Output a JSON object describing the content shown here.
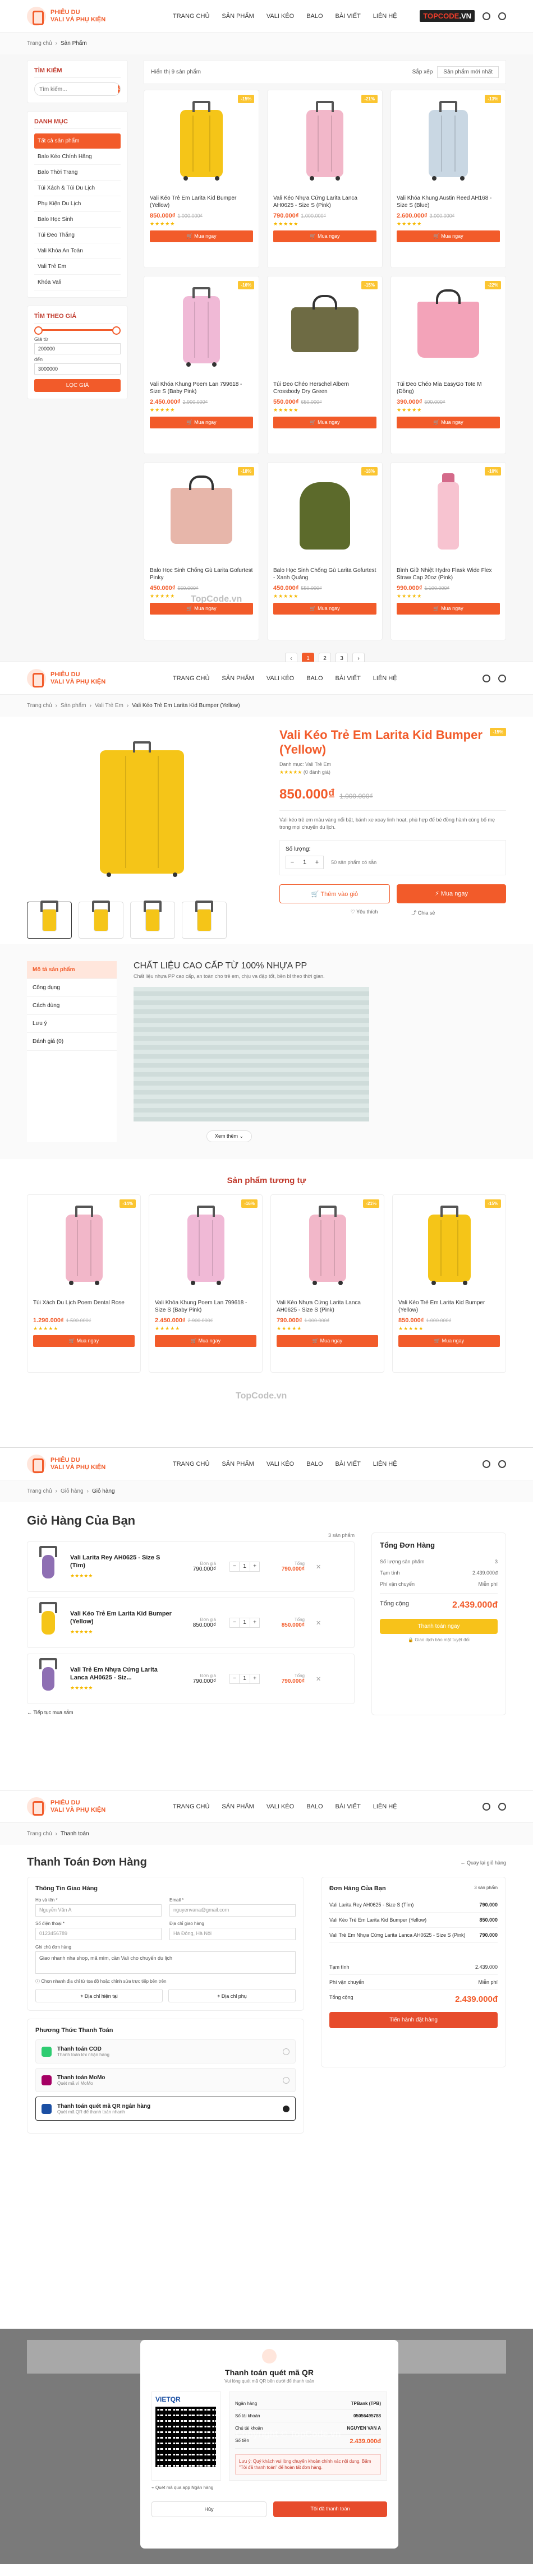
{
  "brand": {
    "line1": "PHIÊU DU",
    "line2": "VALI VÀ PHỤ KIỆN",
    "accent": "#f25b2a"
  },
  "nav": [
    "TRANG CHỦ",
    "SẢN PHẨM",
    "VALI KÉO",
    "BALO",
    "BÀI VIẾT",
    "LIÊN HỆ"
  ],
  "watermark": {
    "pre": "TOPCODE",
    "post": ".VN",
    "text": "Copyright © TopCode.vn",
    "mid": "TopCode.vn"
  },
  "shop": {
    "breadcrumb": [
      "Trang chủ",
      "Sản Phẩm"
    ],
    "search_title": "TÌM KIẾM",
    "search_placeholder": "Tìm kiếm...",
    "cat_title": "DANH MỤC",
    "categories": [
      "Tất cả sản phẩm",
      "Balo Kéo Chính Hãng",
      "Balo Thời Trang",
      "Túi Xách & Túi Du Lịch",
      "Phụ Kiện Du Lịch",
      "Balo Học Sinh",
      "Túi Đeo Thắng",
      "Vali Khóa An Toàn",
      "Vali Trẻ Em",
      "Khóa Vali"
    ],
    "price_title": "TÌM THEO GIÁ",
    "min_label": "Giá từ",
    "min_val": "200000",
    "to_label": "đến",
    "max_val": "3000000",
    "filter_btn": "LỌC GIÁ",
    "found": "Hiển thị 9 sản phẩm",
    "sort_label": "Sắp xếp",
    "sort_val": "Sản phẩm mới nhất",
    "products": [
      {
        "name": "Vali Kéo Trẻ Em Larita Kid Bumper (Yellow)",
        "price": "850.000₫",
        "old": "1.000.000₫",
        "badge": "-15%"
      },
      {
        "name": "Vali Kéo Nhựa Cứng Larita Lanca AH0625 - Size S (Pink)",
        "price": "790.000₫",
        "old": "1.000.000₫",
        "badge": "-21%"
      },
      {
        "name": "Vali Khóa Khung Austin Reed AH168 - Size S (Blue)",
        "price": "2.600.000₫",
        "old": "3.000.000₫",
        "badge": "-13%"
      },
      {
        "name": "Vali Khóa Khung Poem Lan 799618 - Size S (Baby Pink)",
        "price": "2.450.000₫",
        "old": "2.900.000₫",
        "badge": "-16%"
      },
      {
        "name": "Túi Đeo Chéo Herschel Albern Crossbody Dry Green",
        "price": "550.000₫",
        "old": "650.000₫",
        "badge": "-15%"
      },
      {
        "name": "Túi Đeo Chéo Mia EasyGo Tote M (Đồng)",
        "price": "390.000₫",
        "old": "500.000₫",
        "badge": "-22%"
      },
      {
        "name": "Balo Học Sinh Chống Gù Larita Gofurtest Pinky",
        "price": "450.000₫",
        "old": "550.000₫",
        "badge": "-18%"
      },
      {
        "name": "Balo Học Sinh Chống Gù Larita Gofurtest - Xanh Quảng",
        "price": "450.000₫",
        "old": "550.000₫",
        "badge": "-18%"
      },
      {
        "name": "Bình Giữ Nhiệt Hydro Flask Wide Flex Straw Cap 20oz (Pink)",
        "price": "990.000₫",
        "old": "1.100.000₫",
        "badge": "-10%"
      }
    ],
    "buy_label": "Mua ngay",
    "stars": "★★★★★",
    "pages": [
      "‹",
      "1",
      "2",
      "3",
      "›"
    ]
  },
  "detail": {
    "breadcrumb": [
      "Trang chủ",
      "Sản phẩm",
      "Vali Trẻ Em",
      "Vali Kéo Trẻ Em Larita Kid Bumper (Yellow)"
    ],
    "title": "Vali Kéo Trẻ Em Larita Kid Bumper (Yellow)",
    "category": "Danh mục: Vali Trẻ Em",
    "reviews": "(0 đánh giá)",
    "price": "850.000₫",
    "old": "1.000.000₫",
    "badge": "-15%",
    "desc": "Vali kéo trẻ em màu vàng nổi bật, bánh xe xoay linh hoạt, phù hợp để bé đồng hành cùng bố mẹ trong mọi chuyến du lịch.",
    "qty_label": "Số lượng:",
    "qty": "1",
    "stock": "50 sản phẩm có sẵn",
    "add_cart": "Thêm vào giỏ",
    "buy_now": "Mua ngay",
    "fav": "Yêu thích",
    "share": "Chia sẻ",
    "tabs": [
      "Mô tả sản phẩm",
      "Công dụng",
      "Cách dùng",
      "Lưu ý",
      "Đánh giá (0)"
    ],
    "tab_title": "CHẤT LIỆU CAO CẤP TỪ 100% NHỰA PP",
    "tab_sub": "Chất liệu nhựa PP cao cấp, an toàn cho trẻ em, chịu va đập tốt, bền bỉ theo thời gian.",
    "more": "Xem thêm",
    "related_title": "Sản phẩm tương tự",
    "related": [
      {
        "name": "Túi Xách Du Lịch Poem Dental Rose",
        "price": "1.290.000₫",
        "old": "1.500.000₫",
        "badge": "-14%"
      },
      {
        "name": "Vali Khóa Khung Poem Lan 799618 - Size S (Baby Pink)",
        "price": "2.450.000₫",
        "old": "2.900.000₫",
        "badge": "-16%"
      },
      {
        "name": "Vali Kéo Nhựa Cứng Larita Lanca AH0625 - Size S (Pink)",
        "price": "790.000₫",
        "old": "1.000.000₫",
        "badge": "-21%"
      },
      {
        "name": "Vali Kéo Trẻ Em Larita Kid Bumper (Yellow)",
        "price": "850.000₫",
        "old": "1.000.000₫",
        "badge": "-15%"
      }
    ]
  },
  "cart": {
    "breadcrumb": [
      "Trang chủ",
      "Giỏ hàng",
      "Giỏ hàng"
    ],
    "title": "Giỏ Hàng Của Bạn",
    "count": "3 sản phẩm",
    "unit_label": "Đơn giá",
    "total_label": "Tổng",
    "items": [
      {
        "name": "Vali Larita Rey AH0625 - Size S (Tím)",
        "unit": "790.000₫",
        "qty": "1",
        "total": "790.000₫"
      },
      {
        "name": "Vali Kéo Trẻ Em Larita Kid Bumper (Yellow)",
        "unit": "850.000₫",
        "qty": "1",
        "total": "850.000₫"
      },
      {
        "name": "Vali Trẻ Em Nhựa Cứng Larita Lanca AH0625 - Siz...",
        "unit": "790.000₫",
        "qty": "1",
        "total": "790.000₫"
      }
    ],
    "continue": "← Tiếp tục mua sắm",
    "sum_title": "Tổng Đơn Hàng",
    "sum_rows": [
      [
        "Số lượng sản phẩm",
        "3"
      ],
      [
        "Tạm tính",
        "2.439.000đ"
      ],
      [
        "Phí vận chuyển",
        "Miễn phí"
      ]
    ],
    "sum_total_label": "Tổng cộng",
    "sum_total": "2.439.000đ",
    "checkout_btn": "Thanh toán ngay",
    "secure": "Giao dịch bảo mật tuyệt đối"
  },
  "checkout": {
    "breadcrumb": [
      "Trang chủ",
      "Thanh toán"
    ],
    "title": "Thanh Toán Đơn Hàng",
    "back": "← Quay lại giỏ hàng",
    "info_title": "Thông Tin Giao Hàng",
    "fields": [
      [
        "Họ và tên *",
        "Nguyễn Văn A"
      ],
      [
        "Email *",
        "nguyenvana@gmail.com"
      ],
      [
        "Số điện thoại *",
        "0123456789"
      ],
      [
        "Địa chỉ giao hàng",
        "Hà Đông, Hà Nội"
      ]
    ],
    "note_label": "Ghi chú đơn hàng",
    "note_val": "Giao nhanh nha shop, mã mìm, cần Vali cho chuyến du lịch",
    "loc_note": "Chọn nhanh địa chỉ từ tọa độ hoặc chỉnh sửa trực tiếp bên trên",
    "loc_btns": [
      "Địa chỉ hiện tại",
      "Địa chỉ phụ"
    ],
    "pm_title": "Phương Thức Thanh Toán",
    "pms": [
      [
        "Thanh toán COD",
        "Thanh toán khi nhận hàng"
      ],
      [
        "Thanh toán MoMo",
        "Quét mã ví MoMo"
      ],
      [
        "Thanh toán quét mã QR ngân hàng",
        "Quét mã QR để thanh toán nhanh"
      ]
    ],
    "order_title": "Đơn Hàng Của Bạn",
    "order_count": "3 sản phẩm",
    "order_items": [
      [
        "Vali Larita Rey AH0625 - Size S (Tím)",
        "790.000"
      ],
      [
        "Vali Kéo Trẻ Em Larita Kid Bumper (Yellow)",
        "850.000"
      ],
      [
        "Vali Trẻ Em Nhựa Cứng Larita Lanca AH0625 - Size S (Pink)",
        "790.000"
      ]
    ],
    "order_rows": [
      [
        "Tạm tính",
        "2.439.000"
      ],
      [
        "Phí vận chuyển",
        "Miễn phí"
      ]
    ],
    "order_total_label": "Tổng cộng",
    "order_total": "2.439.000đ",
    "place_btn": "Tiến hành đặt hàng"
  },
  "modal": {
    "title": "Thanh toán quét mã QR",
    "sub": "Vui lòng quét mã QR bên dưới để thanh toán",
    "bank": "VIETQR",
    "rows": [
      [
        "Ngân hàng",
        "TPBank (TPB)"
      ],
      [
        "Số tài khoản",
        "05056495788"
      ],
      [
        "Chủ tài khoản",
        "NGUYEN VAN A"
      ],
      [
        "Số tiền",
        "2.439.000đ"
      ]
    ],
    "warn": "Lưu ý: Quý khách vui lòng chuyển khoản chính xác nội dung. Bấm \"Tôi đã thanh toán\" để hoàn tất đơn hàng.",
    "scan": "Quét mã qua app Ngân hàng",
    "cancel": "Hủy",
    "confirm": "Tôi đã thanh toán"
  }
}
